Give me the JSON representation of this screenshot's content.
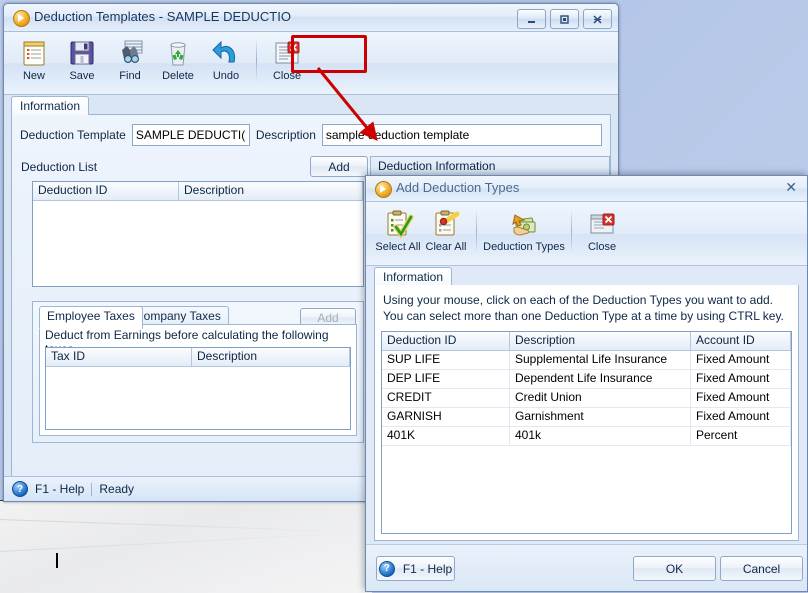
{
  "main_window": {
    "title": "Deduction Templates - SAMPLE DEDUCTIO",
    "window_buttons": {
      "minimize": "—",
      "maximize": "❐",
      "close": "✕"
    },
    "toolbar": [
      {
        "label": "New",
        "icon": "new-document-icon"
      },
      {
        "label": "Save",
        "icon": "floppy-disk-icon"
      },
      {
        "label": "Find",
        "icon": "binoculars-icon"
      },
      {
        "label": "Delete",
        "icon": "recycle-bin-icon"
      },
      {
        "label": "Undo",
        "icon": "undo-arrow-icon"
      },
      {
        "label": "Close",
        "icon": "document-close-icon"
      }
    ],
    "tab": "Information",
    "fields": {
      "deduction_template_label": "Deduction Template",
      "deduction_template_value": "SAMPLE DEDUCTI(",
      "description_label": "Description",
      "description_value": "sample deduction template"
    },
    "deduction_list": {
      "label": "Deduction List",
      "add_button": "Add",
      "columns": [
        "Deduction ID",
        "Description"
      ],
      "rows": []
    },
    "taxes": {
      "tabs": [
        "Employee Taxes",
        "Company Taxes"
      ],
      "active_tab": "Employee Taxes",
      "add_button": "Add",
      "note": "Deduct from Earnings before calculating the following taxes",
      "columns": [
        "Tax ID",
        "Description"
      ],
      "rows": []
    },
    "right_panel": {
      "header": "Deduction Information"
    },
    "statusbar": {
      "help": "F1 - Help",
      "status": "Ready"
    }
  },
  "dialog": {
    "title": "Add Deduction Types",
    "close_x": "✕",
    "toolbar": [
      {
        "label": "Select All",
        "icon": "clipboard-check-icon"
      },
      {
        "label": "Clear All",
        "icon": "clipboard-clear-icon"
      },
      {
        "label": "Deduction Types",
        "icon": "money-hand-icon"
      },
      {
        "label": "Close",
        "icon": "window-close-icon"
      }
    ],
    "tab": "Information",
    "instruction_line1": "Using your mouse, click on each of the Deduction Types you want to add.",
    "instruction_line2": "You can select more than one Deduction Type at a time by using CTRL key.",
    "grid": {
      "columns": [
        "Deduction ID",
        "Description",
        "Account ID"
      ],
      "rows": [
        {
          "id": "SUP LIFE",
          "description": "Supplemental Life Insurance",
          "account": "Fixed Amount"
        },
        {
          "id": "DEP LIFE",
          "description": "Dependent Life Insurance",
          "account": "Fixed Amount"
        },
        {
          "id": "CREDIT",
          "description": "Credit Union",
          "account": "Fixed Amount"
        },
        {
          "id": "GARNISH",
          "description": "Garnishment",
          "account": "Fixed Amount"
        },
        {
          "id": "401K",
          "description": "401k",
          "account": "Percent"
        }
      ]
    },
    "footer": {
      "help": "F1 - Help",
      "ok": "OK",
      "cancel": "Cancel"
    }
  },
  "annotation": {
    "highlight_color": "#cc0000",
    "target": "Add"
  }
}
